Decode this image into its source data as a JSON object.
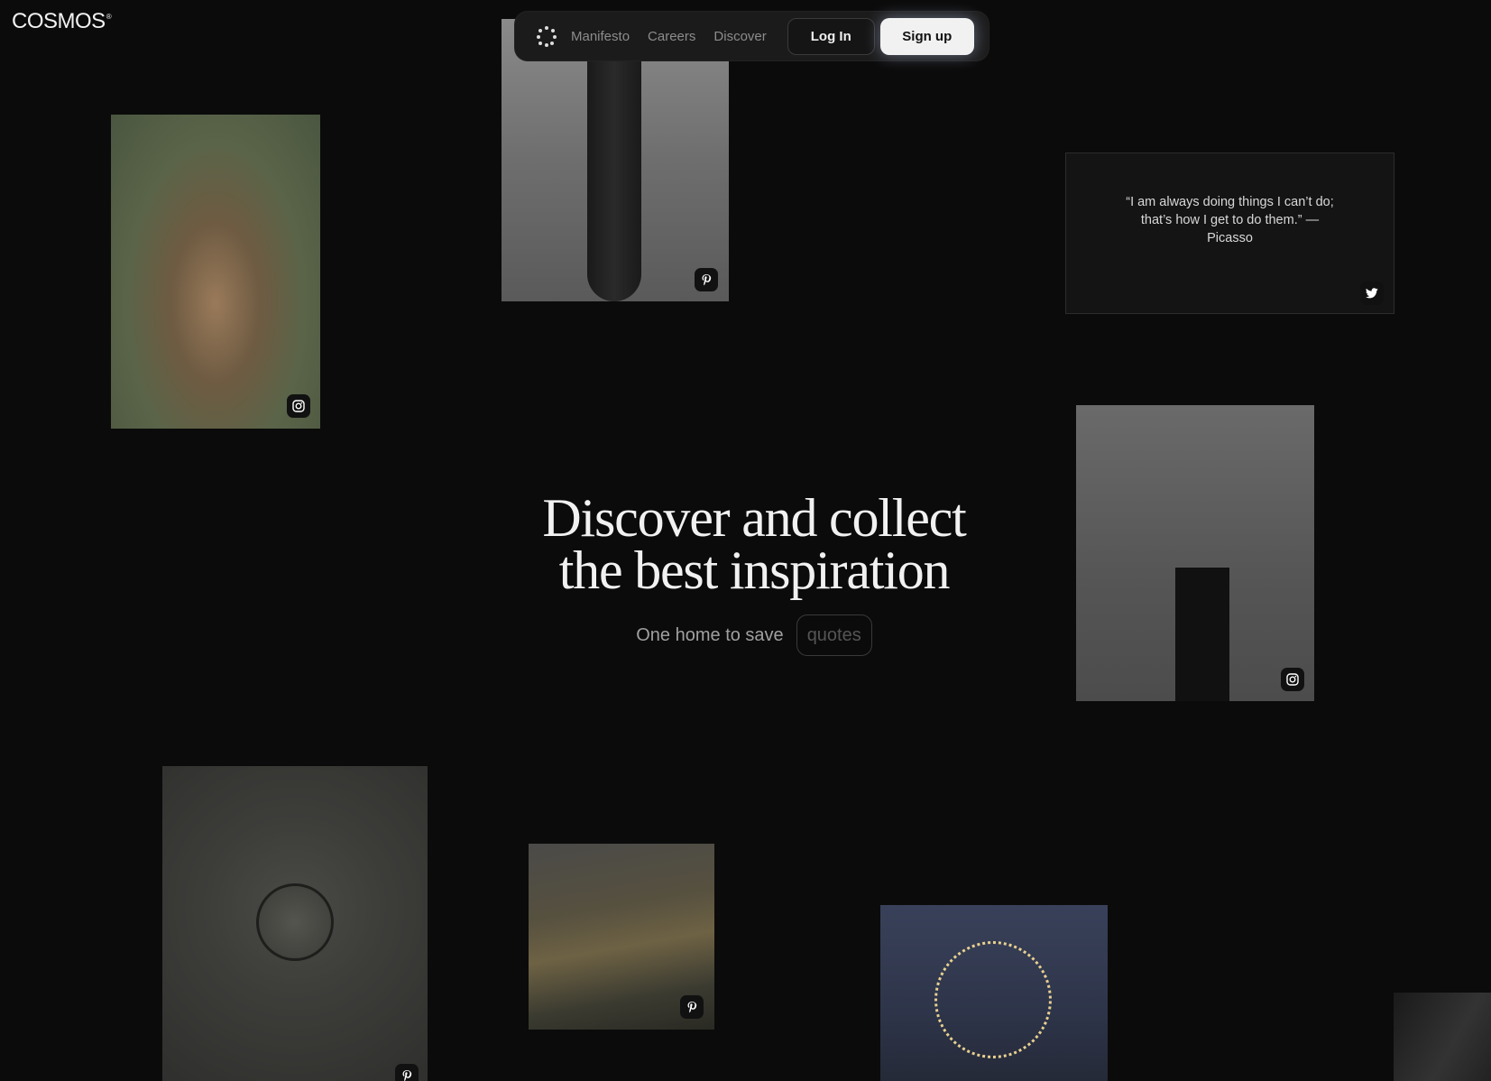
{
  "brand": {
    "name": "COSMOS",
    "mark": "®"
  },
  "nav": {
    "links": [
      "Manifesto",
      "Careers",
      "Discover"
    ],
    "login": "Log In",
    "signup": "Sign up"
  },
  "hero": {
    "line1": "Discover and collect",
    "line2": "the best inspiration",
    "sub": "One home to save",
    "rotating_word": "quotes"
  },
  "quote": {
    "text": "“I am always doing things I can’t do; that’s how I get to do them.” — Picasso",
    "source_icon": "twitter-icon"
  },
  "cards": [
    {
      "source_icon": "instagram-icon"
    },
    {
      "source_icon": "pinterest-icon"
    },
    {
      "source_icon": "instagram-icon"
    },
    {
      "source_icon": "pinterest-icon"
    },
    {
      "source_icon": "pinterest-icon"
    }
  ]
}
